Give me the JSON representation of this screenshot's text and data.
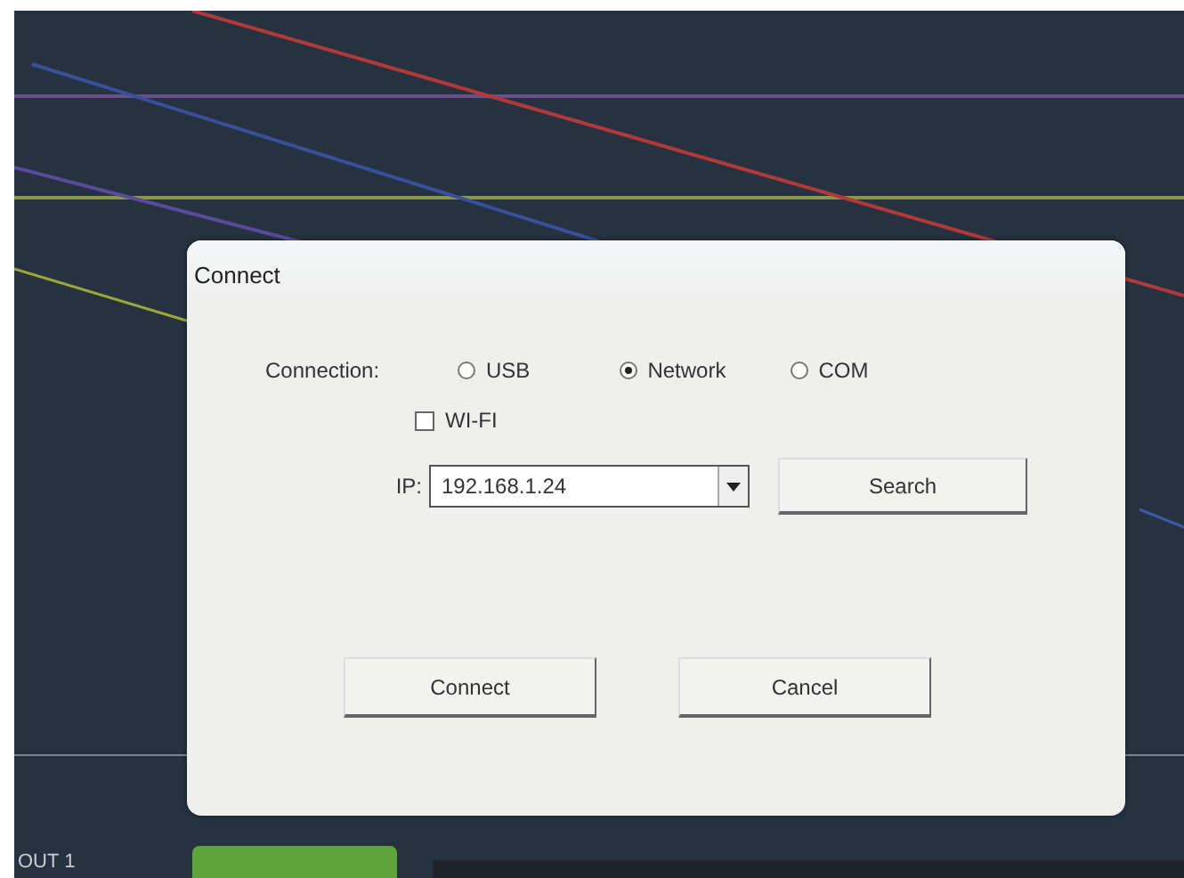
{
  "dialog": {
    "title": "Connect",
    "connection": {
      "label": "Connection:",
      "options": [
        {
          "label": "USB",
          "selected": false
        },
        {
          "label": "Network",
          "selected": true
        },
        {
          "label": "COM",
          "selected": false
        }
      ]
    },
    "wifi": {
      "label": "WI-FI",
      "checked": false
    },
    "ip": {
      "label": "IP:",
      "value": "192.168.1.24"
    },
    "search_button": "Search",
    "buttons": [
      "Connect",
      "Cancel"
    ]
  },
  "bottom_bar": {
    "channel_label": "OUT 1"
  }
}
